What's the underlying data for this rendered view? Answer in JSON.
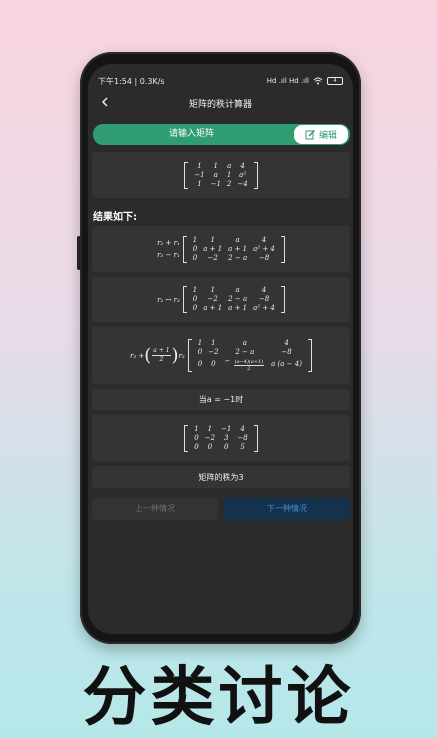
{
  "status": {
    "time_speed": "下午1:54 | 0.3K/s",
    "signal": "Hd .ıll Hd .ıll",
    "battery": "4"
  },
  "header": {
    "title": "矩阵的秩计算器"
  },
  "input": {
    "label": "请输入矩阵",
    "edit_label": "编辑"
  },
  "input_matrix": [
    [
      "1",
      "1",
      "a",
      "4"
    ],
    [
      "−1",
      "a",
      "1",
      "a²"
    ],
    [
      "1",
      "−1",
      "2",
      "−4"
    ]
  ],
  "results_title": "结果如下:",
  "step1": {
    "ops": [
      "r₂ + r₁",
      "r₃ − r₁"
    ],
    "matrix": [
      [
        "1",
        "1",
        "a",
        "4"
      ],
      [
        "0",
        "a + 1",
        "a + 1",
        "a² + 4"
      ],
      [
        "0",
        "−2",
        "2 − a",
        "−8"
      ]
    ]
  },
  "step2": {
    "op": "r₂ ↔ r₃",
    "matrix": [
      [
        "1",
        "1",
        "a",
        "4"
      ],
      [
        "0",
        "−2",
        "2 − a",
        "−8"
      ],
      [
        "0",
        "a + 1",
        "a + 1",
        "a² + 4"
      ]
    ]
  },
  "step3": {
    "op_prefix": "r₃ +",
    "frac_num": "a + 1",
    "frac_den": "2",
    "op_suffix": "r₂",
    "matrix_rows": [
      [
        "1",
        "1",
        "a",
        "4"
      ],
      [
        "0",
        "−2",
        "2 − a",
        "−8"
      ]
    ],
    "row3": {
      "c1": "0",
      "c2": "0",
      "minus": "−",
      "frac_num": "(a−4)(a+1)",
      "frac_den": "2",
      "c4": "a (a − 4)"
    }
  },
  "case_label": "当a = −1时",
  "case_matrix": [
    [
      "1",
      "1",
      "−1",
      "4"
    ],
    [
      "0",
      "−2",
      "3",
      "−8"
    ],
    [
      "0",
      "0",
      "0",
      "5"
    ]
  ],
  "rank_label": "矩阵的秩为3",
  "buttons": {
    "prev": "上一种情况",
    "next": "下一种情况"
  },
  "caption": "分类讨论",
  "colors": {
    "accent": "#2f9c72",
    "next_button": "#3c8fd6",
    "screen_bg": "#2b2b2b",
    "card_bg": "#343434"
  },
  "icons": {
    "back": "chevron-left-icon",
    "edit": "pencil-edit-icon",
    "wifi": "wifi-icon",
    "battery": "battery-icon"
  }
}
